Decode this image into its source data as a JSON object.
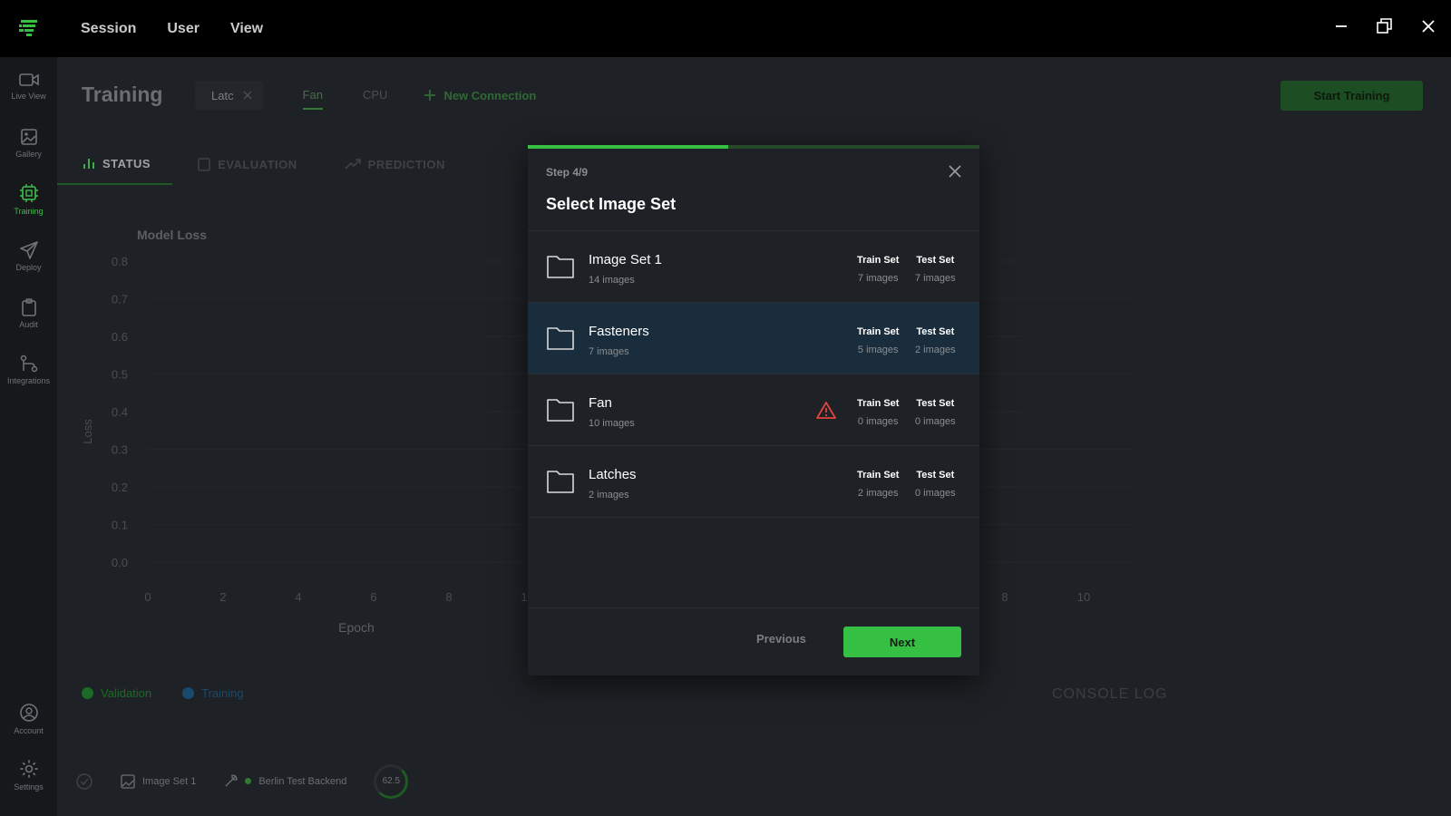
{
  "app": {
    "menu": [
      "Session",
      "User",
      "View"
    ]
  },
  "sidebar": {
    "items": [
      {
        "label": "Live View",
        "icon": "video-camera-icon"
      },
      {
        "label": "Gallery",
        "icon": "image-icon"
      },
      {
        "label": "Training",
        "icon": "chip-icon",
        "active": true
      },
      {
        "label": "Deploy",
        "icon": "paper-plane-icon"
      },
      {
        "label": "Audit",
        "icon": "clipboard-icon"
      },
      {
        "label": "Integrations",
        "icon": "git-icon"
      }
    ],
    "bottom": [
      {
        "label": "Account",
        "icon": "account-icon"
      },
      {
        "label": "Settings",
        "icon": "gear-icon"
      }
    ]
  },
  "main": {
    "title": "Training",
    "chip_label": "Latc",
    "conn_tabs": [
      "Fan",
      "CPU"
    ],
    "new_connection": "New Connection",
    "start_training": "Start Training",
    "sub_tabs": [
      "STATUS",
      "EVALUATION",
      "PREDICTION"
    ],
    "chart_title": "Model Loss",
    "legend": [
      "Validation",
      "Training"
    ],
    "console_log": "CONSOLE LOG",
    "status_bar": {
      "image_set": "Image Set 1",
      "backend": "Berlin Test Backend",
      "gauge_value": "62.5"
    }
  },
  "chart_data": {
    "type": "line",
    "title": "Model Loss",
    "xlabel": "Epoch",
    "ylabel": "Loss",
    "x_ticks_left": [
      "0",
      "2",
      "4",
      "6",
      "8",
      "1"
    ],
    "x_ticks_right": [
      "8",
      "10"
    ],
    "y_ticks": [
      "0.8",
      "0.7",
      "0.6",
      "0.5",
      "0.4",
      "0.3",
      "0.2",
      "0.1",
      "0.0"
    ],
    "ylim": [
      0,
      0.8
    ],
    "series": []
  },
  "modal": {
    "step": "Step 4/9",
    "progress": 0.444,
    "title": "Select Image Set",
    "train_header": "Train Set",
    "test_header": "Test Set",
    "rows": [
      {
        "name": "Image Set 1",
        "count": "14 images",
        "train": "7 images",
        "test": "7 images"
      },
      {
        "name": "Fasteners",
        "count": "7 images",
        "train": "5 images",
        "test": "2 images",
        "selected": true
      },
      {
        "name": "Fan",
        "count": "10 images",
        "train": "0 images",
        "test": "0 images",
        "warning": true
      },
      {
        "name": "Latches",
        "count": "2 images",
        "train": "2 images",
        "test": "0 images"
      }
    ],
    "previous": "Previous",
    "next": "Next"
  },
  "colors": {
    "accent": "#35c043",
    "selected_row": "#1a2d3d",
    "warning": "#e0443e"
  }
}
